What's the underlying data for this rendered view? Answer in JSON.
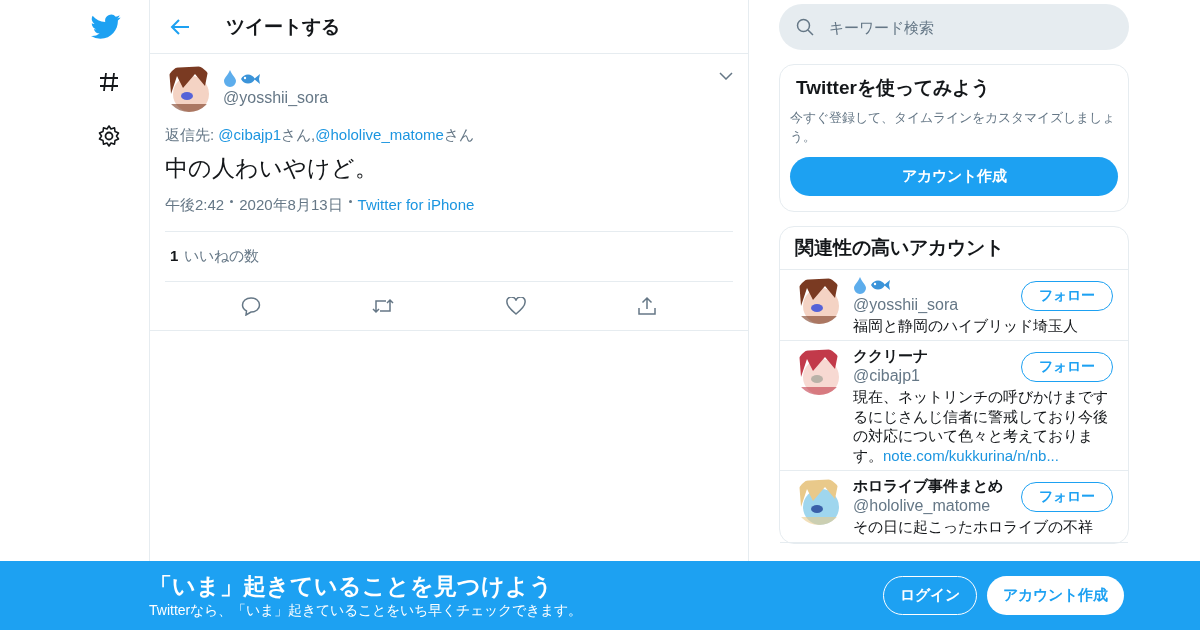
{
  "header": {
    "title": "ツイートする"
  },
  "tweet": {
    "handle": "@yosshii_sora",
    "reply_prefix": "返信先:",
    "reply_to": [
      {
        "handle": "@cibajp1",
        "suffix": "さん,"
      },
      {
        "handle": "@hololive_matome",
        "suffix": "さん"
      }
    ],
    "text": "中の人わいやけど。",
    "time": "午後2:42",
    "date": "2020年8月13日",
    "source": "Twitter for iPhone",
    "likes_count": "1",
    "likes_label": "いいねの数"
  },
  "search": {
    "placeholder": "キーワード検索"
  },
  "signup_card": {
    "title": "Twitterを使ってみよう",
    "text": "今すぐ登録して、タイムラインをカスタマイズしましょう。",
    "button": "アカウント作成"
  },
  "related": {
    "title": "関連性の高いアカウント",
    "accounts": [
      {
        "handle": "@yosshii_sora",
        "bio": "福岡と静岡のハイブリッド埼玉人",
        "button": "フォロー"
      },
      {
        "name": "ククリーナ",
        "handle": "@cibajp1",
        "bio": "現在、ネットリンチの呼びかけまでするにじさんじ信者に警戒しており今後の対応について色々と考えております。",
        "link": "note.com/kukkurina/n/nb...",
        "button": "フォロー"
      },
      {
        "name": "ホロライブ事件まとめ",
        "handle": "@hololive_matome",
        "bio": "その日に起こったホロライブの不祥",
        "button": "フォロー"
      }
    ]
  },
  "banner": {
    "title": "「いま」起きていることを見つけよう",
    "subtitle": "Twitterなら、「いま」起きていることをいち早くチェックできます。",
    "login": "ログイン",
    "signup": "アカウント作成"
  }
}
